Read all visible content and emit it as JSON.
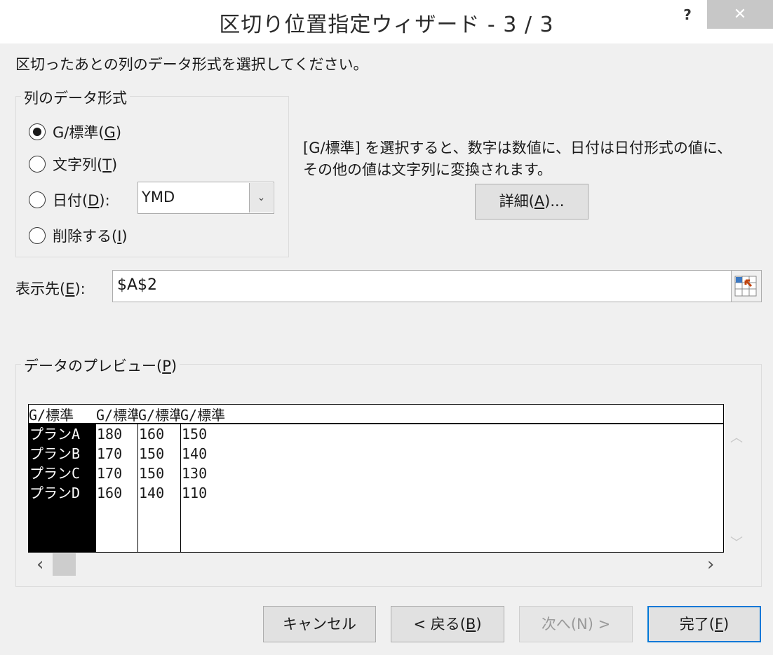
{
  "window": {
    "title": "区切り位置指定ウィザード - 3 / 3",
    "help_label": "?",
    "close_label": "✕"
  },
  "instruction": "区切ったあとの列のデータ形式を選択してください。",
  "column_format": {
    "group_label": "列のデータ形式",
    "options": [
      {
        "label": "G/標準(",
        "key": "G",
        "checked": true
      },
      {
        "label": "文字列(",
        "key": "T",
        "checked": false
      },
      {
        "label": "日付(",
        "key": "D",
        "checked": false
      },
      {
        "label": "削除する(",
        "key": "I",
        "checked": false
      }
    ],
    "date_suffix": "):",
    "close_paren": ")",
    "date_select_value": "YMD",
    "select_arrow": "⌄"
  },
  "description": {
    "line1": "[G/標準] を選択すると、数字は数値に、日付は日付形式の値に、",
    "line2": "その他の値は文字列に変換されます。"
  },
  "advanced_button": {
    "label_pre": "詳細(",
    "key": "A",
    "label_post": ")..."
  },
  "destination": {
    "label_pre": "表示先(",
    "key": "E",
    "label_post": "):",
    "value": "$A$2"
  },
  "preview": {
    "label_pre": "データのプレビュー(",
    "key": "P",
    "label_post": ")",
    "headers": [
      "G/標準",
      "G/標準",
      "G/標準",
      "G/標準"
    ],
    "rows": [
      [
        "プランA",
        "180",
        "160",
        "150"
      ],
      [
        "プランB",
        "170",
        "150",
        "140"
      ],
      [
        "プランC",
        "170",
        "150",
        "130"
      ],
      [
        "プランD",
        "160",
        "140",
        "110"
      ]
    ],
    "scroll_up": "︿",
    "scroll_down": "﹀",
    "scroll_left": "‹",
    "scroll_right": "›"
  },
  "buttons": {
    "cancel": "キャンセル",
    "back_pre": "< 戻る(",
    "back_key": "B",
    "back_post": ")",
    "next": "次へ(N) >",
    "finish_pre": "完了(",
    "finish_key": "F",
    "finish_post": ")"
  },
  "colors": {
    "dialog_bg": "#f0f0f0",
    "selected_column_bg": "#000000",
    "finish_border": "#0078d7"
  }
}
